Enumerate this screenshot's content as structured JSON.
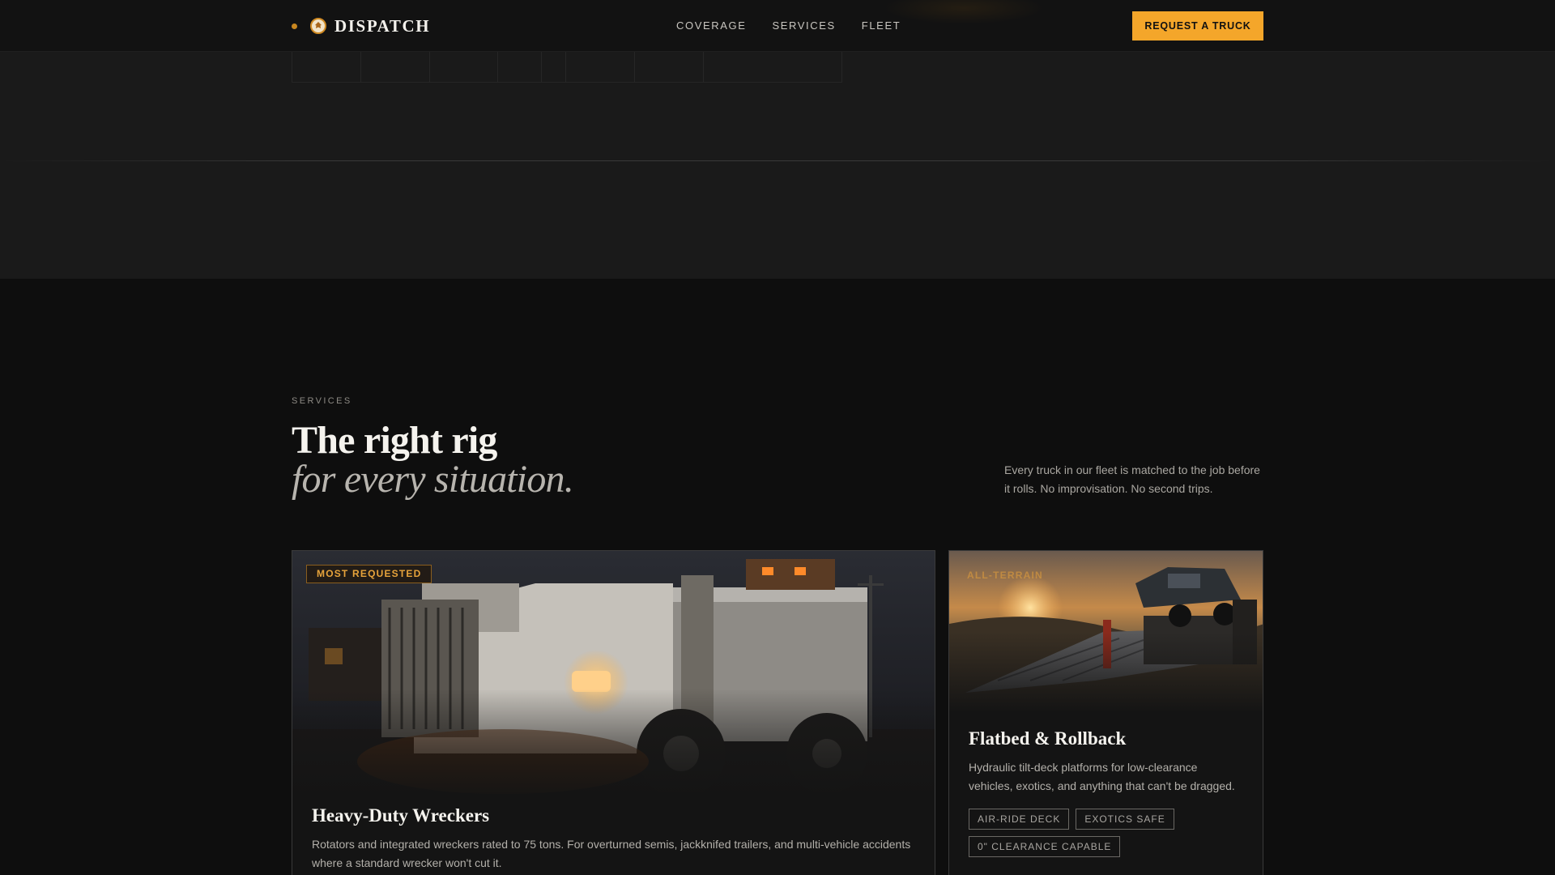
{
  "nav": {
    "brand": "DISPATCH",
    "links": [
      "COVERAGE",
      "SERVICES",
      "FLEET"
    ],
    "cta": "REQUEST A TRUCK"
  },
  "services": {
    "eyebrow": "SERVICES",
    "headline": "The right rig",
    "headline_italic": "for every situation.",
    "intro": "Every truck in our fleet is matched to the job before it rolls. No improvisation. No second trips."
  },
  "cards": [
    {
      "badge": "MOST REQUESTED",
      "title": "Heavy-Duty Wreckers",
      "description": "Rotators and integrated wreckers rated to 75 tons. For overturned semis, jackknifed trailers, and multi-vehicle accidents where a standard wrecker won't cut it."
    },
    {
      "badge": "ALL-TERRAIN",
      "title": "Flatbed & Rollback",
      "description": "Hydraulic tilt-deck platforms for low-clearance vehicles, exotics, and anything that can't be dragged.",
      "tags": [
        "AIR-RIDE DECK",
        "EXOTICS SAFE",
        "0\" CLEARANCE CAPABLE"
      ]
    }
  ],
  "colors": {
    "accent": "#f4a62a",
    "background": "#0e0e0e",
    "band": "#1a1a1a"
  },
  "icons": {
    "brand": "eagle-emblem-icon"
  }
}
